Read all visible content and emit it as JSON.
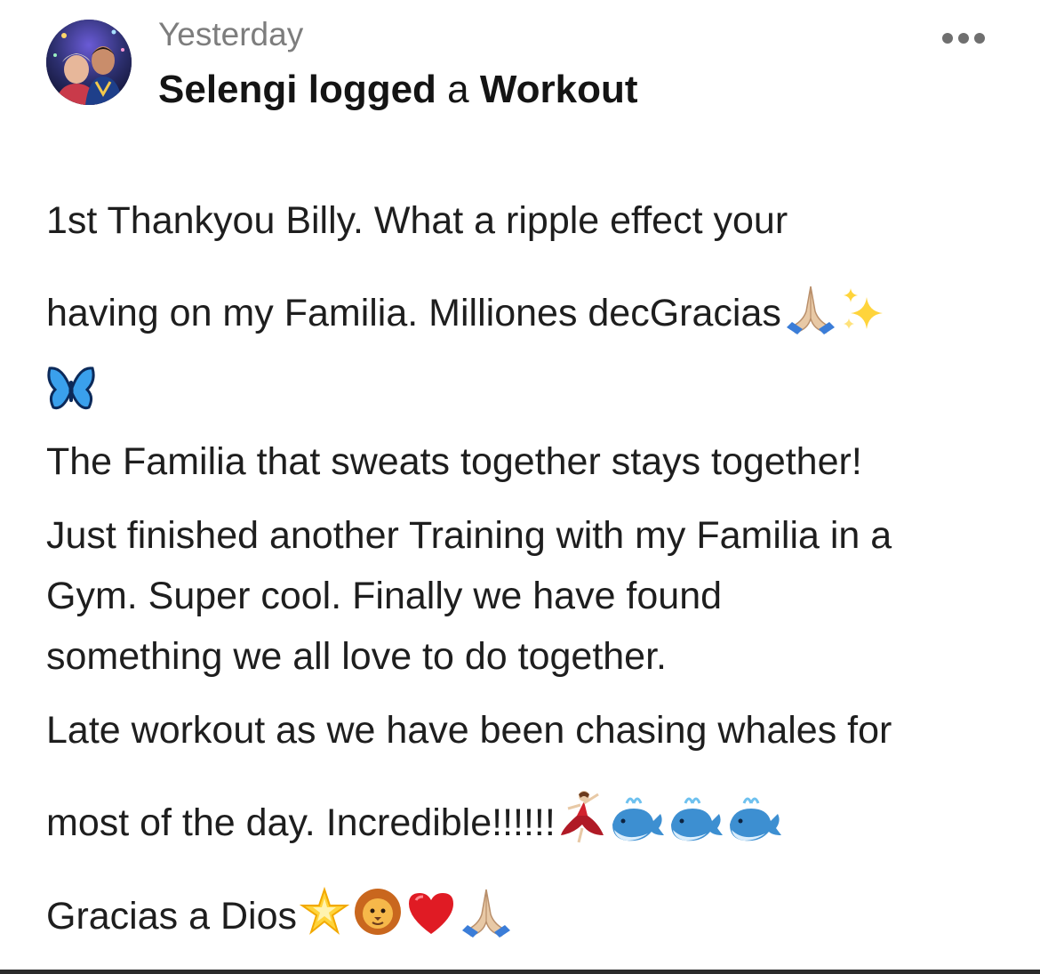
{
  "post": {
    "timestamp": "Yesterday",
    "author": "Selengi",
    "verb": "logged",
    "article": "a",
    "activity": "Workout",
    "more_icon": "more-horizontal-icon",
    "avatar_icon": "user-avatar"
  },
  "body": {
    "line1": "1st Thankyou Billy. What a ripple effect your",
    "line2": "having on my Familia. Milliones decGracias",
    "line2_emojis": [
      "folded-hands-icon",
      "sparkles-icon"
    ],
    "line3_emojis": [
      "butterfly-icon"
    ],
    "line4": "The Familia that sweats together stays together!",
    "line5": "Just finished another Training with my Familia in a",
    "line6": "Gym. Super cool. Finally we have found",
    "line7": "something we all love to do together.",
    "line8": "Late workout as we have been chasing whales for",
    "line9": "most of the day. Incredible!!!!!!",
    "line9_emojis": [
      "dancer-icon",
      "spouting-whale-icon",
      "spouting-whale-icon",
      "spouting-whale-icon"
    ],
    "line10": "Gracias a Dios",
    "line10_emojis": [
      "glowing-star-icon",
      "lion-icon",
      "red-heart-icon",
      "folded-hands-icon"
    ]
  },
  "colors": {
    "timestamp": "#7d7d7d",
    "text": "#1e1e1e",
    "more_dots": "#6f6f6f"
  }
}
